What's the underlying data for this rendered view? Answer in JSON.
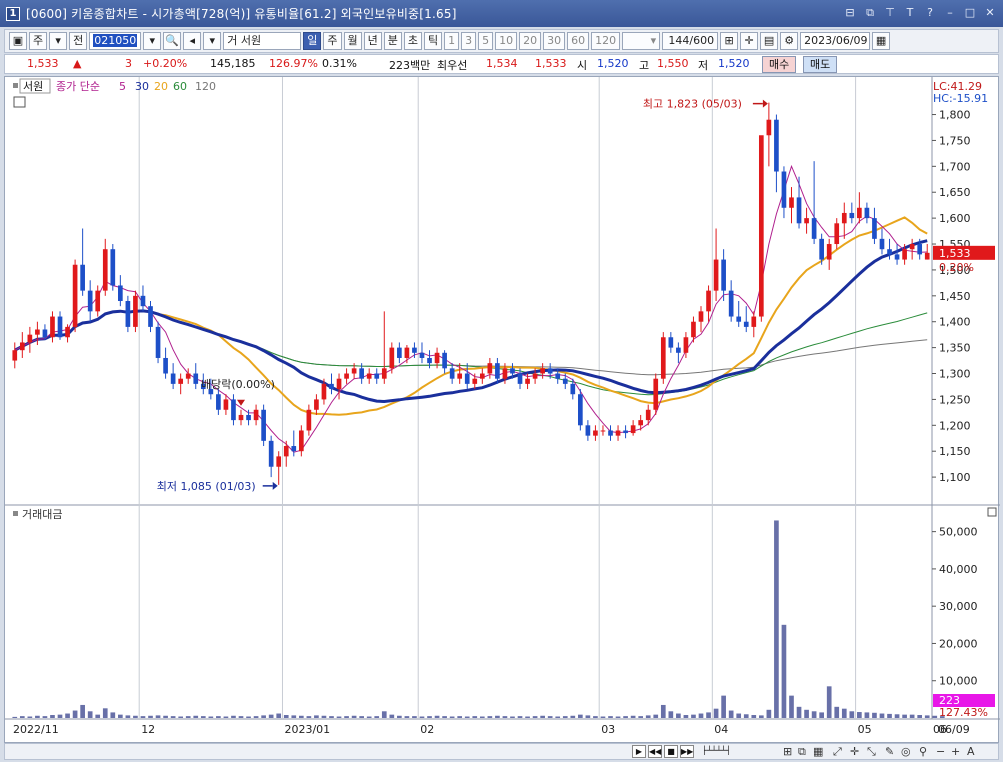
{
  "window": {
    "title": "[0600] 키움종합차트 - 시가총액[728(억)] 유통비율[61.2] 외국인보유비중[1.65]",
    "app_number": "1"
  },
  "toolbar": {
    "market": "주",
    "market2": "전",
    "code": "021050",
    "name": "서원",
    "periods": [
      "일",
      "주",
      "월",
      "년",
      "분",
      "초",
      "틱"
    ],
    "active_period": "일",
    "intervals": [
      "1",
      "3",
      "5",
      "10",
      "20",
      "30",
      "60",
      "120"
    ],
    "count": "144",
    "count_max": "/600",
    "date": "2023/06/09"
  },
  "quote": {
    "price": "1,533",
    "change_arrow": "▲",
    "change": "3",
    "change_pct": "+0.20%",
    "volume": "145,185",
    "vol_ratio": "126.97%",
    "turnover": "0.31%",
    "amount": "223백만",
    "best_label": "최우선",
    "ask": "1,534",
    "bid": "1,533",
    "open_label": "시",
    "open": "1,520",
    "high_label": "고",
    "high": "1,550",
    "low_label": "저",
    "low": "1,520",
    "buy_label": "매수",
    "sell_label": "매도"
  },
  "price_panel": {
    "stock_label": "서원",
    "legend_prefix": "종가 단순",
    "ma_periods": [
      "5",
      "30",
      "20",
      "60",
      "120"
    ],
    "ma_colors": [
      "#b0208e",
      "#1a2f9c",
      "#e8a51c",
      "#2a8c3a",
      "#777777"
    ],
    "lc": "LC:41.29",
    "hc": "HC:-15.91",
    "last_price_tag": "1,533",
    "last_change_tag": "0.20%",
    "high_annotation": "최고 1,823 (05/03)",
    "low_annotation": "최저 1,085 (01/03)",
    "dividend_annotation": "배당락(0.00%)"
  },
  "volume_panel": {
    "label": "거래대금",
    "last_tag": "223",
    "ratio_tag": "127.43%"
  },
  "chart_data": [
    {
      "type": "candlestick",
      "title": "",
      "ylim": [
        1050,
        1830
      ],
      "y_ticks": [
        1100,
        1150,
        1200,
        1250,
        1300,
        1350,
        1400,
        1450,
        1500,
        1550,
        1600,
        1650,
        1700,
        1750,
        1800
      ],
      "y_tick_labels": [
        "1,100",
        "1,150",
        "1,200",
        "1,250",
        "1,300",
        "1,350",
        "1,400",
        "1,450",
        "1,500",
        "1,550",
        "1,600",
        "1,650",
        "1,700",
        "1,750",
        "1,800"
      ],
      "x_labels": [
        "2022/11",
        "12",
        "2023/01",
        "02",
        "03",
        "04",
        "05",
        "06",
        "06/09"
      ],
      "high": {
        "value": 1823,
        "date": "05/03"
      },
      "low": {
        "value": 1085,
        "date": "01/03"
      },
      "ohlc": [
        [
          1325,
          1360,
          1310,
          1345
        ],
        [
          1345,
          1380,
          1330,
          1360
        ],
        [
          1360,
          1390,
          1340,
          1375
        ],
        [
          1375,
          1400,
          1355,
          1385
        ],
        [
          1385,
          1395,
          1365,
          1370
        ],
        [
          1370,
          1420,
          1360,
          1410
        ],
        [
          1410,
          1420,
          1365,
          1370
        ],
        [
          1370,
          1395,
          1360,
          1390
        ],
        [
          1390,
          1520,
          1380,
          1510
        ],
        [
          1510,
          1580,
          1450,
          1460
        ],
        [
          1460,
          1480,
          1400,
          1420
        ],
        [
          1420,
          1470,
          1410,
          1460
        ],
        [
          1460,
          1560,
          1450,
          1540
        ],
        [
          1540,
          1550,
          1460,
          1470
        ],
        [
          1470,
          1490,
          1430,
          1440
        ],
        [
          1440,
          1450,
          1380,
          1390
        ],
        [
          1390,
          1460,
          1380,
          1450
        ],
        [
          1450,
          1470,
          1420,
          1430
        ],
        [
          1430,
          1440,
          1380,
          1390
        ],
        [
          1390,
          1400,
          1320,
          1330
        ],
        [
          1330,
          1350,
          1290,
          1300
        ],
        [
          1300,
          1320,
          1270,
          1280
        ],
        [
          1280,
          1300,
          1260,
          1290
        ],
        [
          1290,
          1310,
          1280,
          1300
        ],
        [
          1300,
          1320,
          1270,
          1280
        ],
        [
          1280,
          1300,
          1260,
          1270
        ],
        [
          1270,
          1290,
          1250,
          1260
        ],
        [
          1260,
          1270,
          1220,
          1230
        ],
        [
          1230,
          1260,
          1220,
          1250
        ],
        [
          1250,
          1260,
          1200,
          1210
        ],
        [
          1210,
          1230,
          1200,
          1220
        ],
        [
          1220,
          1230,
          1200,
          1210
        ],
        [
          1210,
          1240,
          1200,
          1230
        ],
        [
          1230,
          1240,
          1160,
          1170
        ],
        [
          1170,
          1180,
          1100,
          1120
        ],
        [
          1120,
          1150,
          1085,
          1140
        ],
        [
          1140,
          1170,
          1120,
          1160
        ],
        [
          1160,
          1190,
          1140,
          1150
        ],
        [
          1150,
          1200,
          1140,
          1190
        ],
        [
          1190,
          1240,
          1180,
          1230
        ],
        [
          1230,
          1260,
          1220,
          1250
        ],
        [
          1250,
          1290,
          1240,
          1280
        ],
        [
          1280,
          1300,
          1260,
          1270
        ],
        [
          1270,
          1300,
          1250,
          1290
        ],
        [
          1290,
          1310,
          1280,
          1300
        ],
        [
          1300,
          1320,
          1290,
          1310
        ],
        [
          1310,
          1320,
          1280,
          1290
        ],
        [
          1290,
          1310,
          1280,
          1300
        ],
        [
          1300,
          1310,
          1280,
          1290
        ],
        [
          1290,
          1420,
          1280,
          1310
        ],
        [
          1310,
          1360,
          1300,
          1350
        ],
        [
          1350,
          1360,
          1320,
          1330
        ],
        [
          1330,
          1355,
          1320,
          1350
        ],
        [
          1350,
          1360,
          1330,
          1340
        ],
        [
          1340,
          1360,
          1320,
          1330
        ],
        [
          1330,
          1345,
          1310,
          1320
        ],
        [
          1320,
          1350,
          1310,
          1340
        ],
        [
          1340,
          1345,
          1300,
          1310
        ],
        [
          1310,
          1320,
          1280,
          1290
        ],
        [
          1290,
          1320,
          1280,
          1300
        ],
        [
          1300,
          1320,
          1270,
          1280
        ],
        [
          1280,
          1300,
          1270,
          1290
        ],
        [
          1290,
          1310,
          1280,
          1300
        ],
        [
          1300,
          1330,
          1290,
          1320
        ],
        [
          1320,
          1330,
          1280,
          1290
        ],
        [
          1290,
          1320,
          1280,
          1310
        ],
        [
          1310,
          1320,
          1290,
          1300
        ],
        [
          1300,
          1310,
          1270,
          1280
        ],
        [
          1280,
          1300,
          1270,
          1290
        ],
        [
          1290,
          1310,
          1280,
          1300
        ],
        [
          1300,
          1320,
          1290,
          1310
        ],
        [
          1310,
          1320,
          1290,
          1300
        ],
        [
          1300,
          1310,
          1280,
          1290
        ],
        [
          1290,
          1300,
          1270,
          1280
        ],
        [
          1280,
          1290,
          1250,
          1260
        ],
        [
          1260,
          1270,
          1190,
          1200
        ],
        [
          1200,
          1210,
          1170,
          1180
        ],
        [
          1180,
          1200,
          1170,
          1190
        ],
        [
          1190,
          1200,
          1180,
          1190
        ],
        [
          1190,
          1200,
          1170,
          1180
        ],
        [
          1180,
          1200,
          1170,
          1190
        ],
        [
          1190,
          1200,
          1175,
          1185
        ],
        [
          1185,
          1210,
          1180,
          1200
        ],
        [
          1200,
          1220,
          1190,
          1210
        ],
        [
          1210,
          1240,
          1200,
          1230
        ],
        [
          1230,
          1300,
          1220,
          1290
        ],
        [
          1290,
          1380,
          1280,
          1370
        ],
        [
          1370,
          1380,
          1340,
          1350
        ],
        [
          1350,
          1360,
          1320,
          1340
        ],
        [
          1340,
          1380,
          1330,
          1370
        ],
        [
          1370,
          1410,
          1360,
          1400
        ],
        [
          1400,
          1430,
          1380,
          1420
        ],
        [
          1420,
          1470,
          1400,
          1460
        ],
        [
          1460,
          1580,
          1440,
          1520
        ],
        [
          1520,
          1540,
          1440,
          1460
        ],
        [
          1460,
          1480,
          1400,
          1410
        ],
        [
          1410,
          1440,
          1390,
          1400
        ],
        [
          1400,
          1430,
          1380,
          1390
        ],
        [
          1390,
          1420,
          1370,
          1410
        ],
        [
          1410,
          1480,
          1400,
          1760
        ],
        [
          1760,
          1823,
          1700,
          1790
        ],
        [
          1790,
          1800,
          1650,
          1690
        ],
        [
          1690,
          1700,
          1600,
          1620
        ],
        [
          1620,
          1660,
          1590,
          1640
        ],
        [
          1640,
          1680,
          1580,
          1590
        ],
        [
          1590,
          1620,
          1570,
          1600
        ],
        [
          1600,
          1710,
          1550,
          1560
        ],
        [
          1560,
          1570,
          1510,
          1520
        ],
        [
          1520,
          1560,
          1500,
          1550
        ],
        [
          1550,
          1600,
          1540,
          1590
        ],
        [
          1590,
          1630,
          1560,
          1610
        ],
        [
          1610,
          1630,
          1590,
          1600
        ],
        [
          1600,
          1650,
          1590,
          1620
        ],
        [
          1620,
          1630,
          1590,
          1600
        ],
        [
          1600,
          1620,
          1550,
          1560
        ],
        [
          1560,
          1580,
          1530,
          1540
        ],
        [
          1540,
          1560,
          1520,
          1530
        ],
        [
          1530,
          1550,
          1510,
          1520
        ],
        [
          1520,
          1550,
          1510,
          1540
        ],
        [
          1540,
          1560,
          1520,
          1550
        ],
        [
          1550,
          1560,
          1520,
          1530
        ],
        [
          1520,
          1550,
          1520,
          1533
        ]
      ]
    },
    {
      "type": "bar",
      "title": "거래대금",
      "ylim": [
        0,
        55000
      ],
      "y_ticks": [
        10000,
        20000,
        30000,
        40000,
        50000
      ],
      "y_tick_labels": [
        "10,000",
        "20,000",
        "30,000",
        "40,000",
        "50,000"
      ],
      "values": [
        300,
        500,
        400,
        600,
        500,
        800,
        900,
        1200,
        2000,
        3500,
        1800,
        900,
        2600,
        1500,
        900,
        700,
        600,
        500,
        600,
        700,
        600,
        500,
        400,
        500,
        600,
        500,
        400,
        500,
        400,
        600,
        500,
        400,
        500,
        700,
        900,
        1200,
        800,
        700,
        600,
        500,
        700,
        600,
        500,
        400,
        500,
        600,
        500,
        400,
        500,
        1800,
        900,
        600,
        500,
        500,
        400,
        500,
        600,
        500,
        400,
        500,
        400,
        500,
        400,
        500,
        600,
        500,
        400,
        500,
        400,
        500,
        600,
        500,
        400,
        500,
        600,
        900,
        700,
        500,
        400,
        500,
        400,
        500,
        600,
        500,
        700,
        900,
        3500,
        1800,
        1200,
        800,
        900,
        1200,
        1500,
        2500,
        6000,
        2000,
        1200,
        1000,
        800,
        700,
        2200,
        53000,
        25000,
        6000,
        3000,
        2200,
        1800,
        1500,
        8500,
        3000,
        2500,
        1800,
        1600,
        1500,
        1400,
        1200,
        1100,
        1000,
        900,
        900,
        800,
        700,
        600,
        500
      ]
    }
  ]
}
